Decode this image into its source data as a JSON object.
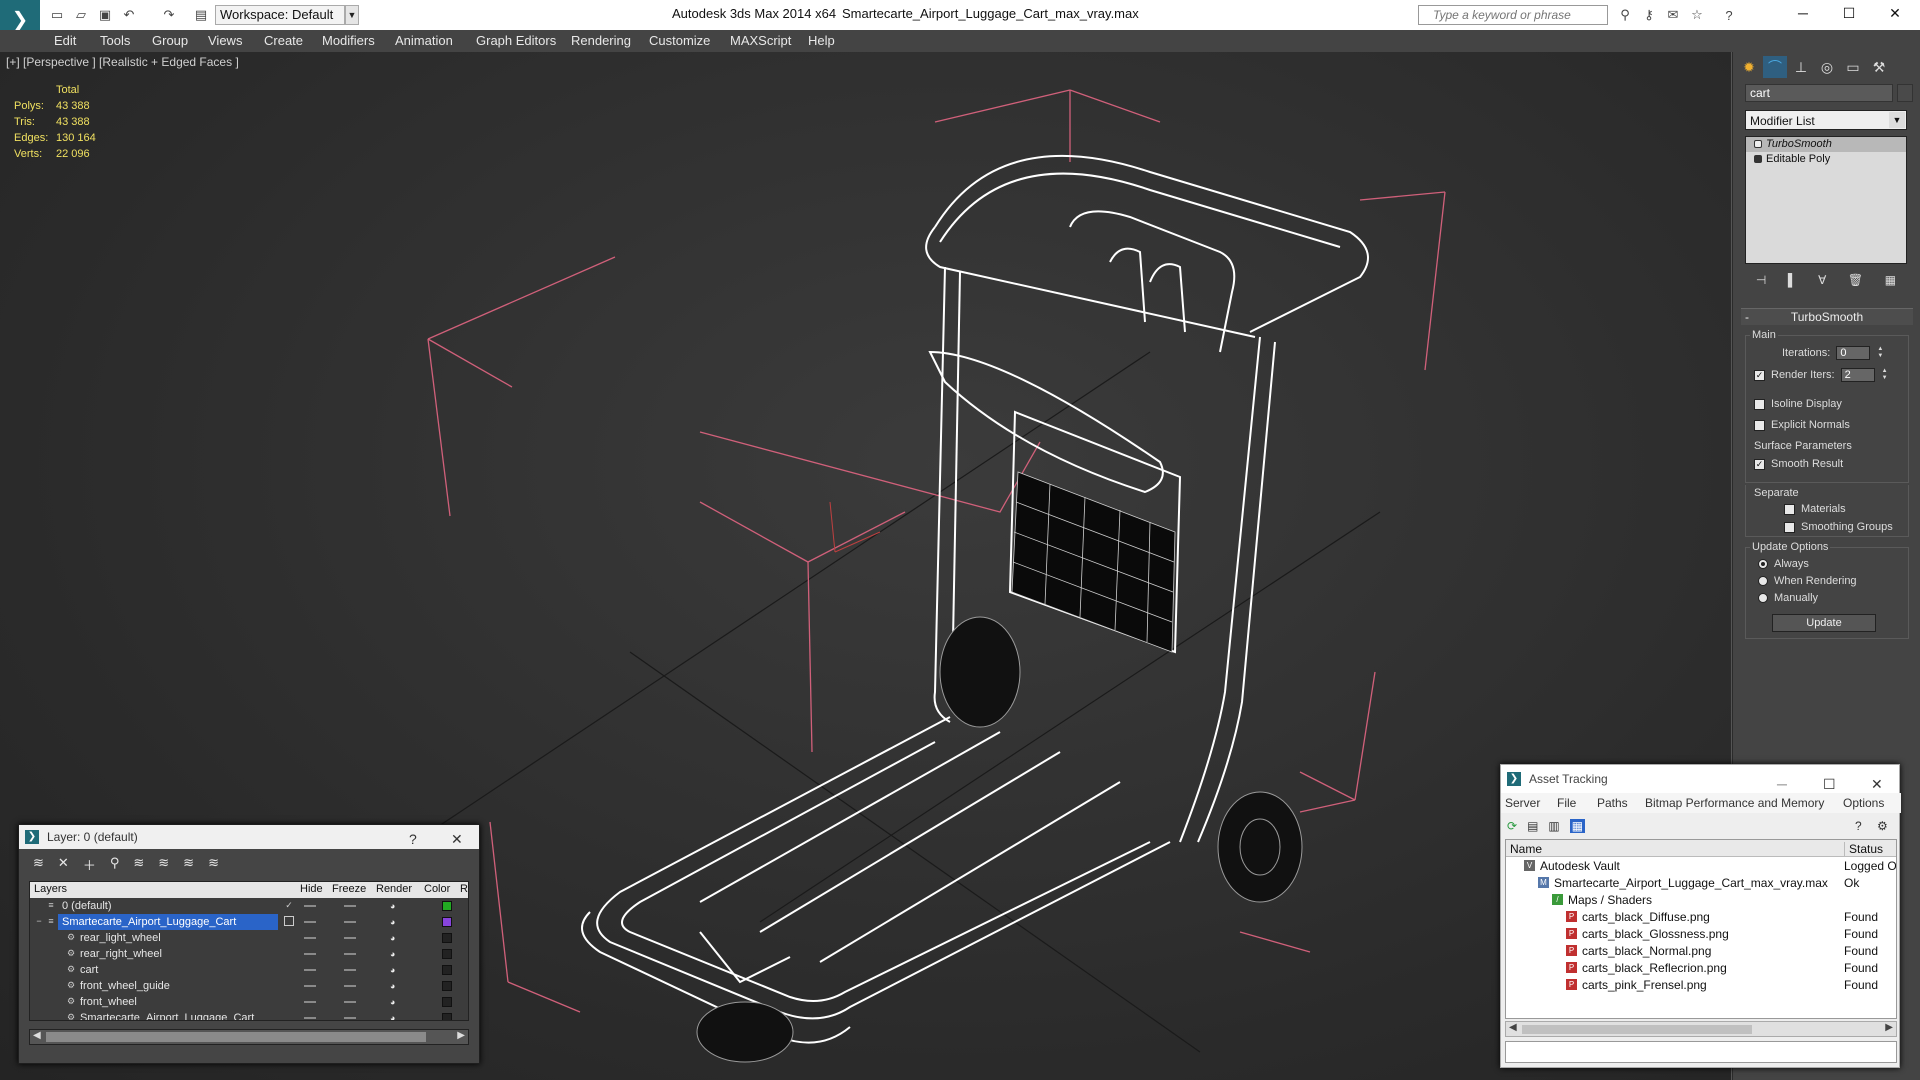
{
  "titlebar": {
    "workspace": "Workspace: Default",
    "app_title": "Autodesk 3ds Max  2014 x64",
    "doc_title": "Smartecarte_Airport_Luggage_Cart_max_vray.max",
    "search_placeholder": "Type a keyword or phrase"
  },
  "menubar": {
    "items": [
      "Edit",
      "Tools",
      "Group",
      "Views",
      "Create",
      "Modifiers",
      "Animation",
      "Graph Editors",
      "Rendering",
      "Customize",
      "MAXScript",
      "Help"
    ]
  },
  "viewport": {
    "label": "[+] [Perspective ] [Realistic + Edged Faces ]",
    "stats": {
      "header": "Total",
      "rows": [
        {
          "label": "Polys:",
          "value": "43 388"
        },
        {
          "label": "Tris:",
          "value": "43 388"
        },
        {
          "label": "Edges:",
          "value": "130 164"
        },
        {
          "label": "Verts:",
          "value": "22 096"
        }
      ]
    }
  },
  "command_panel": {
    "object_name": "cart",
    "modifier_list": "Modifier List",
    "stack": [
      "TurboSmooth",
      "Editable Poly"
    ],
    "rollout_title": "TurboSmooth",
    "main_label": "Main",
    "iterations_label": "Iterations:",
    "iterations_value": "0",
    "render_iters_label": "Render Iters:",
    "render_iters_value": "2",
    "isoline": "Isoline Display",
    "explicit_normals": "Explicit Normals",
    "surface_params": "Surface Parameters",
    "smooth_result": "Smooth Result",
    "separate": "Separate",
    "materials": "Materials",
    "smoothing_groups": "Smoothing Groups",
    "update_options": "Update Options",
    "always": "Always",
    "when_rendering": "When Rendering",
    "manually": "Manually",
    "update_btn": "Update"
  },
  "layer_dialog": {
    "title": "Layer: 0 (default)",
    "help": "?",
    "headers": {
      "layers": "Layers",
      "hide": "Hide",
      "freeze": "Freeze",
      "render": "Render",
      "color": "Color",
      "r": "R"
    },
    "rows": [
      {
        "name": "0 (default)",
        "color": "#22aa22"
      },
      {
        "name": "Smartecarte_Airport_Luggage_Cart",
        "color": "#8844dd"
      },
      {
        "name": "rear_light_wheel",
        "color": "#222222"
      },
      {
        "name": "rear_right_wheel",
        "color": "#222222"
      },
      {
        "name": "cart",
        "color": "#222222"
      },
      {
        "name": "front_wheel_guide",
        "color": "#222222"
      },
      {
        "name": "front_wheel",
        "color": "#222222"
      },
      {
        "name": "Smartecarte_Airport_Luggage_Cart",
        "color": "#222222"
      }
    ]
  },
  "asset_dialog": {
    "title": "Asset Tracking",
    "menu": [
      "Server",
      "File",
      "Paths",
      "Bitmap Performance and Memory",
      "Options"
    ],
    "headers": {
      "name": "Name",
      "status": "Status"
    },
    "rows": [
      {
        "name": "Autodesk Vault",
        "status": "Logged O"
      },
      {
        "name": "Smartecarte_Airport_Luggage_Cart_max_vray.max",
        "status": "Ok"
      },
      {
        "name": "Maps / Shaders",
        "status": ""
      },
      {
        "name": "carts_black_Diffuse.png",
        "status": "Found"
      },
      {
        "name": "carts_black_Glossness.png",
        "status": "Found"
      },
      {
        "name": "carts_black_Normal.png",
        "status": "Found"
      },
      {
        "name": "carts_black_Reflecrion.png",
        "status": "Found"
      },
      {
        "name": "carts_pink_Frensel.png",
        "status": "Found"
      }
    ]
  },
  "colors": {
    "accent": "#1f6b78",
    "selection": "#2a64c8",
    "stats": "#f0e060",
    "bbox": "#d0607a"
  }
}
